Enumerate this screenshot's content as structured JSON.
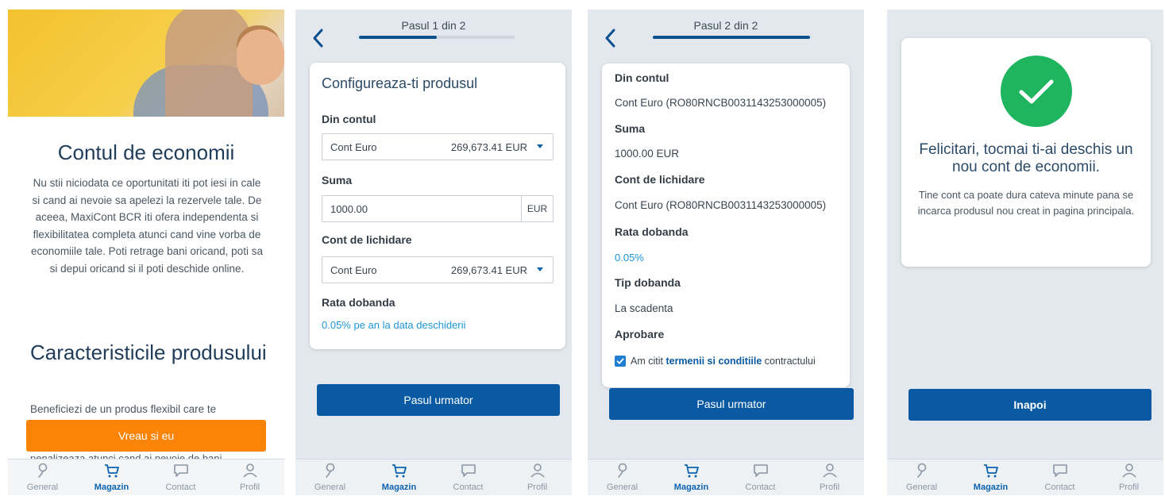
{
  "nav": {
    "items": [
      {
        "label": "General",
        "icon": "location-pin-icon"
      },
      {
        "label": "Magazin",
        "icon": "cart-icon"
      },
      {
        "label": "Contact",
        "icon": "chat-bubble-icon"
      },
      {
        "label": "Profil",
        "icon": "user-icon"
      }
    ],
    "active": "Magazin",
    "active_color": "#0a63b0"
  },
  "screen1": {
    "title": "Contul de economii",
    "description": "Nu stii niciodata ce oportunitati iti pot iesi in cale si cand ai nevoie sa apelezi la rezervele tale. De aceea, MaxiCont BCR iti ofera independenta si flexibilitatea completa atunci cand vine vorba de economiile tale. Poti retrage bani oricand, poti sa si depui oricand si il poti deschide online.",
    "features_heading": "Caracteristicile produsului",
    "features_text": "Beneficiezi de un produs flexibil care te",
    "features_text_cut": "penalizeaza atunci cand ai nevoie de bani",
    "cta_label": "Vreau si eu",
    "cta_color": "#fb8305"
  },
  "screen2": {
    "step_label": "Pasul 1 din 2",
    "progress": 0.5,
    "card_title": "Configureaza-ti produsul",
    "from_account_label": "Din contul",
    "from_account_value": "Cont Euro",
    "from_account_amount": "269,673.41 EUR",
    "amount_label": "Suma",
    "amount_value": "1000.00",
    "amount_currency": "EUR",
    "settlement_label": "Cont de lichidare",
    "settlement_value": "Cont Euro",
    "settlement_amount": "269,673.41 EUR",
    "rate_label": "Rata dobanda",
    "rate_value": "0.05% pe an la data deschiderii",
    "next_button": "Pasul urmator"
  },
  "screen3": {
    "step_label": "Pasul 2 din 2",
    "progress": 1.0,
    "from_account_label": "Din contul",
    "from_account_value": "Cont Euro (RO80RNCB0031143253000005)",
    "amount_label": "Suma",
    "amount_value": "1000.00 EUR",
    "settlement_label": "Cont de lichidare",
    "settlement_value": "Cont Euro (RO80RNCB0031143253000005)",
    "rate_label": "Rata dobanda",
    "rate_value": "0.05%",
    "rate_type_label": "Tip dobanda",
    "rate_type_value": "La scadenta",
    "approval_label": "Aprobare",
    "approval_prefix": "Am citit ",
    "approval_terms": "termenii si conditiile",
    "approval_suffix": " contractului",
    "approval_checked": true,
    "next_button": "Pasul urmator"
  },
  "screen4": {
    "title": "Felicitari, tocmai ti-ai deschis un nou cont de economii.",
    "message": "Tine cont ca poate dura cateva minute pana se incarca produsul nou creat in pagina principala.",
    "back_button": "Inapoi",
    "success_color": "#1fb55f"
  }
}
